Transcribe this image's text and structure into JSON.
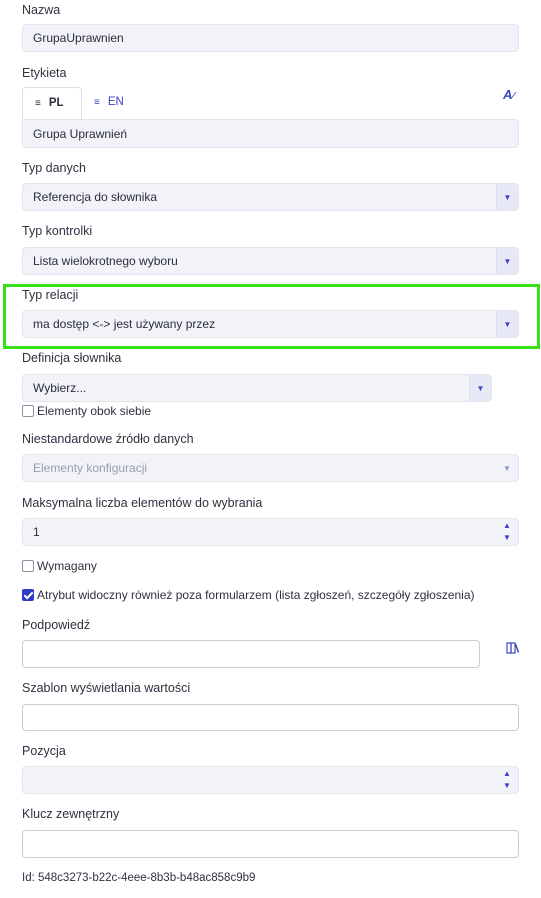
{
  "nazwa": {
    "label": "Nazwa",
    "value": "GrupaUprawnien"
  },
  "etykieta": {
    "label": "Etykieta",
    "tabs": [
      {
        "code": "PL",
        "active": true
      },
      {
        "code": "EN",
        "active": false
      }
    ],
    "value": "Grupa Uprawnień",
    "translate_icon": "translate-icon"
  },
  "typ_danych": {
    "label": "Typ danych",
    "value": "Referencja do słownika"
  },
  "typ_kontrolki": {
    "label": "Typ kontrolki",
    "value": "Lista wielokrotnego wyboru"
  },
  "typ_relacji": {
    "label": "Typ relacji",
    "value": "ma dostęp <-> jest używany przez",
    "highlight_color": "#39e119"
  },
  "definicja_slownika": {
    "label": "Definicja słownika",
    "placeholder": "Wybierz..."
  },
  "elementy_obok": {
    "label": "Elementy obok siebie",
    "checked": false
  },
  "zrodlo_danych": {
    "label": "Niestandardowe źródło danych",
    "value": "Elementy konfiguracji"
  },
  "max_liczba": {
    "label": "Maksymalna liczba elementów do wybrania",
    "value": "1"
  },
  "wymagany": {
    "label": "Wymagany",
    "checked": false
  },
  "widoczny": {
    "label": "Atrybut widoczny również poza formularzem (lista zgłoszeń, szczegóły zgłoszenia)",
    "checked": true
  },
  "podpowiedz": {
    "label": "Podpowiedź",
    "value": "",
    "side_icon": "book-icon"
  },
  "szablon": {
    "label": "Szablon wyświetlania wartości",
    "value": ""
  },
  "pozycja": {
    "label": "Pozycja",
    "value": ""
  },
  "klucz": {
    "label": "Klucz zewnętrzny",
    "value": ""
  },
  "id_text": "Id: 548c3273-b22c-4eee-8b3b-b48ac858c9b9",
  "colors": {
    "accent": "#2f3ac9",
    "field_bg": "#f2f3f9",
    "highlight": "#39e119"
  }
}
